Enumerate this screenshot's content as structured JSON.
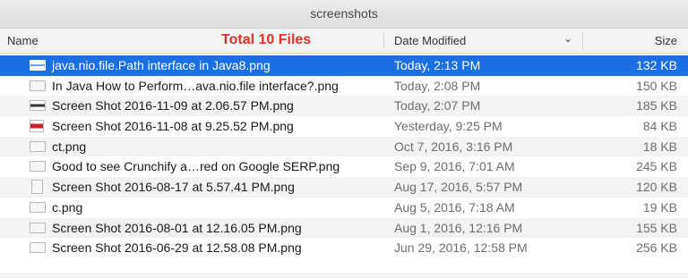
{
  "window": {
    "title": "screenshots"
  },
  "header": {
    "name_label": "Name",
    "annotation": "Total 10 Files",
    "date_label": "Date Modified",
    "size_label": "Size",
    "sort_icon": "chevron-down-icon"
  },
  "accent_color": "#1a6fe3",
  "annotation_color": "#e2312a",
  "files": [
    {
      "name": "java.nio.file.Path interface in Java8.png",
      "date": "Today, 2:13 PM",
      "size": "132 KB",
      "selected": true,
      "icon": "image-thumbnail-icon"
    },
    {
      "name": "In Java How to Perform…ava.nio.file interface?.png",
      "date": "Today, 2:08 PM",
      "size": "150 KB",
      "selected": false,
      "icon": "image-thumbnail-icon"
    },
    {
      "name": "Screen Shot 2016-11-09 at 2.06.57 PM.png",
      "date": "Today, 2:07 PM",
      "size": "185 KB",
      "selected": false,
      "icon": "image-thumbnail-icon"
    },
    {
      "name": "Screen Shot 2016-11-08 at 9.25.52 PM.png",
      "date": "Yesterday, 9:25 PM",
      "size": "84 KB",
      "selected": false,
      "icon": "image-thumbnail-icon"
    },
    {
      "name": "ct.png",
      "date": "Oct 7, 2016, 3:16 PM",
      "size": "18 KB",
      "selected": false,
      "icon": "image-thumbnail-icon"
    },
    {
      "name": "Good to see Crunchify a…red on Google SERP.png",
      "date": "Sep 9, 2016, 7:01 AM",
      "size": "245 KB",
      "selected": false,
      "icon": "image-thumbnail-icon"
    },
    {
      "name": "Screen Shot 2016-08-17 at 5.57.41 PM.png",
      "date": "Aug 17, 2016, 5:57 PM",
      "size": "120 KB",
      "selected": false,
      "icon": "document-icon"
    },
    {
      "name": "c.png",
      "date": "Aug 5, 2016, 7:18 AM",
      "size": "19 KB",
      "selected": false,
      "icon": "image-thumbnail-icon"
    },
    {
      "name": "Screen Shot 2016-08-01 at 12.16.05 PM.png",
      "date": "Aug 1, 2016, 12:16 PM",
      "size": "155 KB",
      "selected": false,
      "icon": "image-thumbnail-icon"
    },
    {
      "name": "Screen Shot 2016-06-29 at 12.58.08 PM.png",
      "date": "Jun 29, 2016, 12:58 PM",
      "size": "256 KB",
      "selected": false,
      "icon": "image-thumbnail-icon"
    }
  ]
}
